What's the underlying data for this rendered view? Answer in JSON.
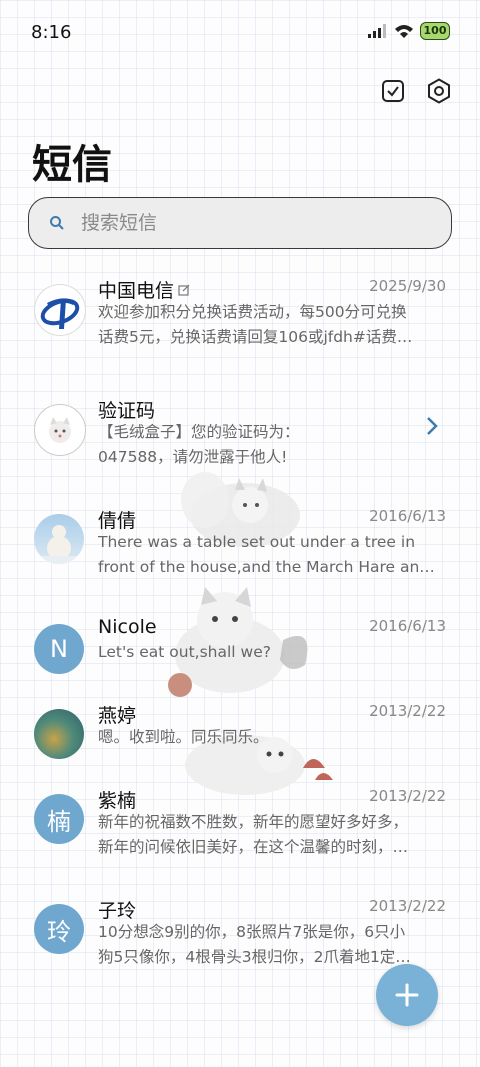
{
  "status": {
    "time": "8:16",
    "battery": "100"
  },
  "header": {
    "title": "短信"
  },
  "search": {
    "placeholder": "搜索短信"
  },
  "threads": [
    {
      "name": "中国电信",
      "date": "2025/9/30",
      "lines": [
        "欢迎参加积分兑换话费活动，每500分可兑换",
        "话费5元，兑换话费请回复106或jfdh#话费…"
      ]
    },
    {
      "name": "验证码",
      "date": "",
      "lines": [
        "【毛绒盒子】您的验证码为：",
        "047588，请勿泄露于他人!"
      ]
    },
    {
      "name": "倩倩",
      "date": "2016/6/13",
      "lines": [
        "There was a table set out under a tree in",
        "front of the house,and the March Hare an…"
      ]
    },
    {
      "name": "Nicole",
      "date": "2016/6/13",
      "avatar": "N",
      "lines": [
        "Let's eat out,shall we?"
      ]
    },
    {
      "name": "燕婷",
      "date": "2013/2/22",
      "lines": [
        "嗯。收到啦。同乐同乐。"
      ]
    },
    {
      "name": "紫楠",
      "date": "2013/2/22",
      "avatar": "楠",
      "lines": [
        "新年的祝福数不胜数，新年的愿望好多好多，",
        "新年的问候依旧美好，在这个温馨的时刻，…"
      ]
    },
    {
      "name": "子玲",
      "date": "2013/2/22",
      "avatar": "玲",
      "lines": [
        "10分想念9别的你，8张照片7张是你，6只小",
        "狗5只像你，4根骨头3根归你，2爪着地1定…"
      ]
    }
  ],
  "colors": {
    "accent": "#79b2d6",
    "avatar": "#6fa7cf",
    "telecom": "#1e4fa8"
  }
}
